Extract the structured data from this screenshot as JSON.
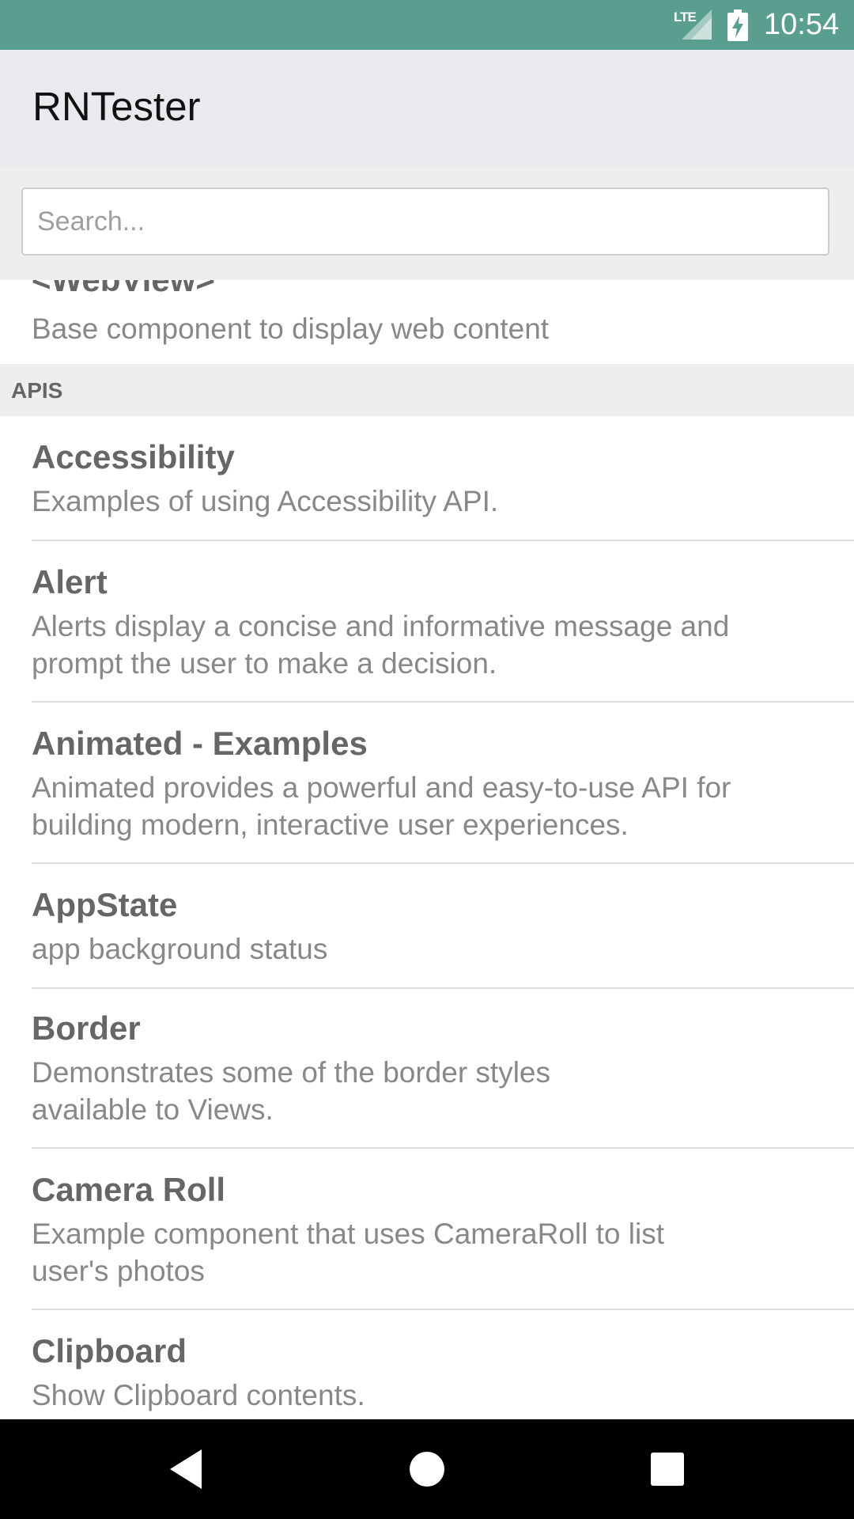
{
  "status_bar": {
    "network": "LTE",
    "time": "10:54"
  },
  "toolbar": {
    "title": "RNTester"
  },
  "search": {
    "placeholder": "Search...",
    "value": ""
  },
  "list": {
    "top_item": {
      "title": "<WebView>",
      "description": "Base component to display web content"
    },
    "section_header": "APIS",
    "items": [
      {
        "title": "Accessibility",
        "description": "Examples of using Accessibility API."
      },
      {
        "title": "Alert",
        "description": "Alerts display a concise and informative message and prompt the user to make a decision."
      },
      {
        "title": "Animated - Examples",
        "description": "Animated provides a powerful and easy-to-use API for building modern, interactive user experiences."
      },
      {
        "title": "AppState",
        "description": "app background status"
      },
      {
        "title": "Border",
        "description": "Demonstrates some of the border styles available to Views."
      },
      {
        "title": "Camera Roll",
        "description": "Example component that uses CameraRoll to list user's photos"
      },
      {
        "title": "Clipboard",
        "description": "Show Clipboard contents."
      }
    ]
  },
  "nav_bar": {
    "back_icon": "back-triangle-icon",
    "home_icon": "home-circle-icon",
    "recents_icon": "recents-square-icon"
  },
  "colors": {
    "status_bar": "#5a9e8f",
    "toolbar": "#e9eaed",
    "section_header": "#eeeeee"
  }
}
